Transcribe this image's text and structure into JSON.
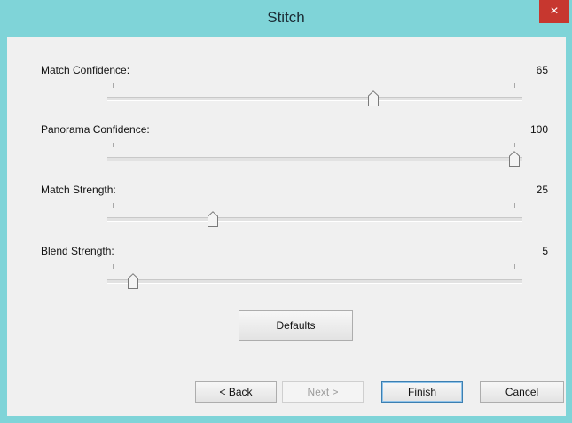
{
  "window": {
    "title": "Stitch",
    "close_glyph": "×"
  },
  "sliders": [
    {
      "label": "Match Confidence:",
      "value": "65",
      "level": 0.65
    },
    {
      "label": "Panorama Confidence:",
      "value": "100",
      "level": 1.0
    },
    {
      "label": "Match Strength:",
      "value": "25",
      "level": 0.25
    },
    {
      "label": "Blend Strength:",
      "value": "5",
      "level": 0.05
    }
  ],
  "buttons": {
    "defaults": "Defaults",
    "back": "< Back",
    "next": "Next >",
    "finish": "Finish",
    "cancel": "Cancel"
  },
  "icons": {
    "close": "close-icon",
    "thumb": "slider-thumb-icon"
  }
}
